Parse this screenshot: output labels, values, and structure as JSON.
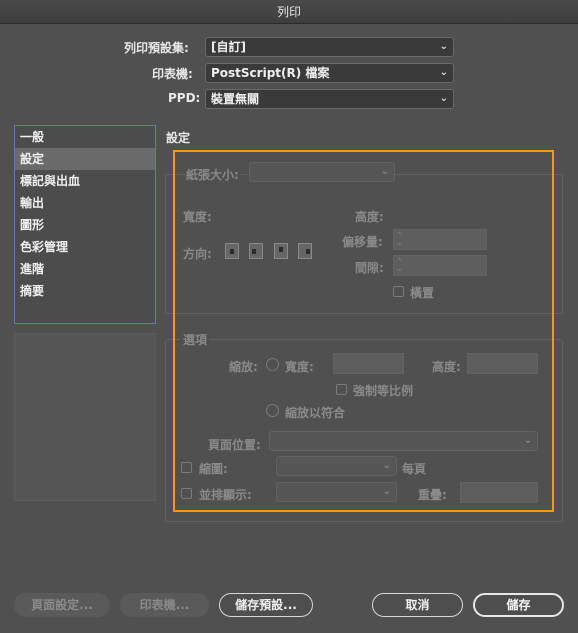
{
  "window": {
    "title": "列印"
  },
  "top_fields": {
    "preset_label": "列印預設集:",
    "preset_value": "[自訂]",
    "printer_label": "印表機:",
    "printer_value": "PostScript(R) 檔案",
    "ppd_label": "PPD:",
    "ppd_value": "裝置無關"
  },
  "sidebar": {
    "items": [
      {
        "label": "一般",
        "selected": false
      },
      {
        "label": "設定",
        "selected": true
      },
      {
        "label": "標記與出血",
        "selected": false
      },
      {
        "label": "輸出",
        "selected": false
      },
      {
        "label": "圖形",
        "selected": false
      },
      {
        "label": "色彩管理",
        "selected": false
      },
      {
        "label": "進階",
        "selected": false
      },
      {
        "label": "摘要",
        "selected": false
      }
    ]
  },
  "settings": {
    "section_title": "設定",
    "paper": {
      "size_label": "紙張大小:",
      "size_value": "",
      "width_label": "寬度:",
      "height_label": "高度:",
      "orientation_label": "方向:",
      "offset_label": "偏移量:",
      "gap_label": "間隙:",
      "transverse_label": "橫置"
    },
    "options": {
      "group_title": "選項",
      "scale_label": "縮放:",
      "scale_width_label": "寬度:",
      "scale_height_label": "高度:",
      "constrain_label": "強制等比例",
      "scale_to_fit_label": "縮放以符合",
      "page_position_label": "頁面位置:",
      "thumbnails_label": "縮圖:",
      "per_page_label": "每頁",
      "tile_label": "並排顯示:",
      "overlap_label": "重疊:"
    }
  },
  "footer": {
    "page_setup": "頁面設定...",
    "printer": "印表機...",
    "save_preset": "儲存預設...",
    "cancel": "取消",
    "save": "儲存"
  },
  "colors": {
    "highlight_border": "#f59a10",
    "background": "#505050",
    "list_border": "#5a7fb8"
  }
}
